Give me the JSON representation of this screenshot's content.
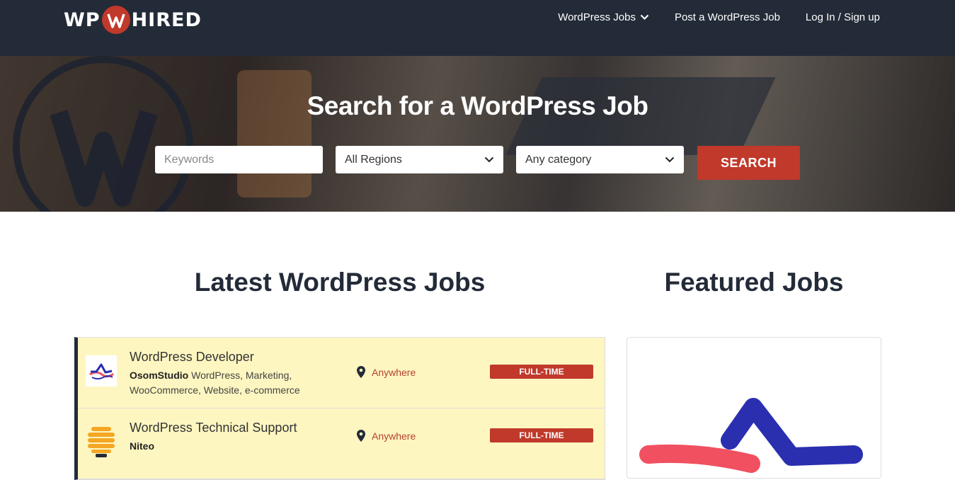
{
  "header": {
    "logo": {
      "left": "WP",
      "right": "HIRED"
    },
    "nav": [
      {
        "label": "WordPress Jobs"
      },
      {
        "label": "Post a WordPress Job"
      },
      {
        "label": "Log In / Sign up"
      }
    ]
  },
  "hero": {
    "title": "Search for a WordPress Job",
    "keywords_placeholder": "Keywords",
    "region_selected": "All Regions",
    "category_selected": "Any category",
    "search_label": "SEARCH"
  },
  "sections": {
    "latest_title": "Latest WordPress Jobs",
    "featured_title": "Featured Jobs"
  },
  "jobs": [
    {
      "title": "WordPress Developer",
      "company": "OsomStudio",
      "tags": "WordPress, Marketing, WooCommerce, Website, e-commerce",
      "location": "Anywhere",
      "type": "FULL-TIME"
    },
    {
      "title": "WordPress Technical Support",
      "company": "Niteo",
      "tags": "",
      "location": "Anywhere",
      "type": "FULL-TIME"
    }
  ],
  "colors": {
    "accent": "#c0392b",
    "header_bg": "#232b38",
    "job_bg": "#fdf6c0"
  }
}
